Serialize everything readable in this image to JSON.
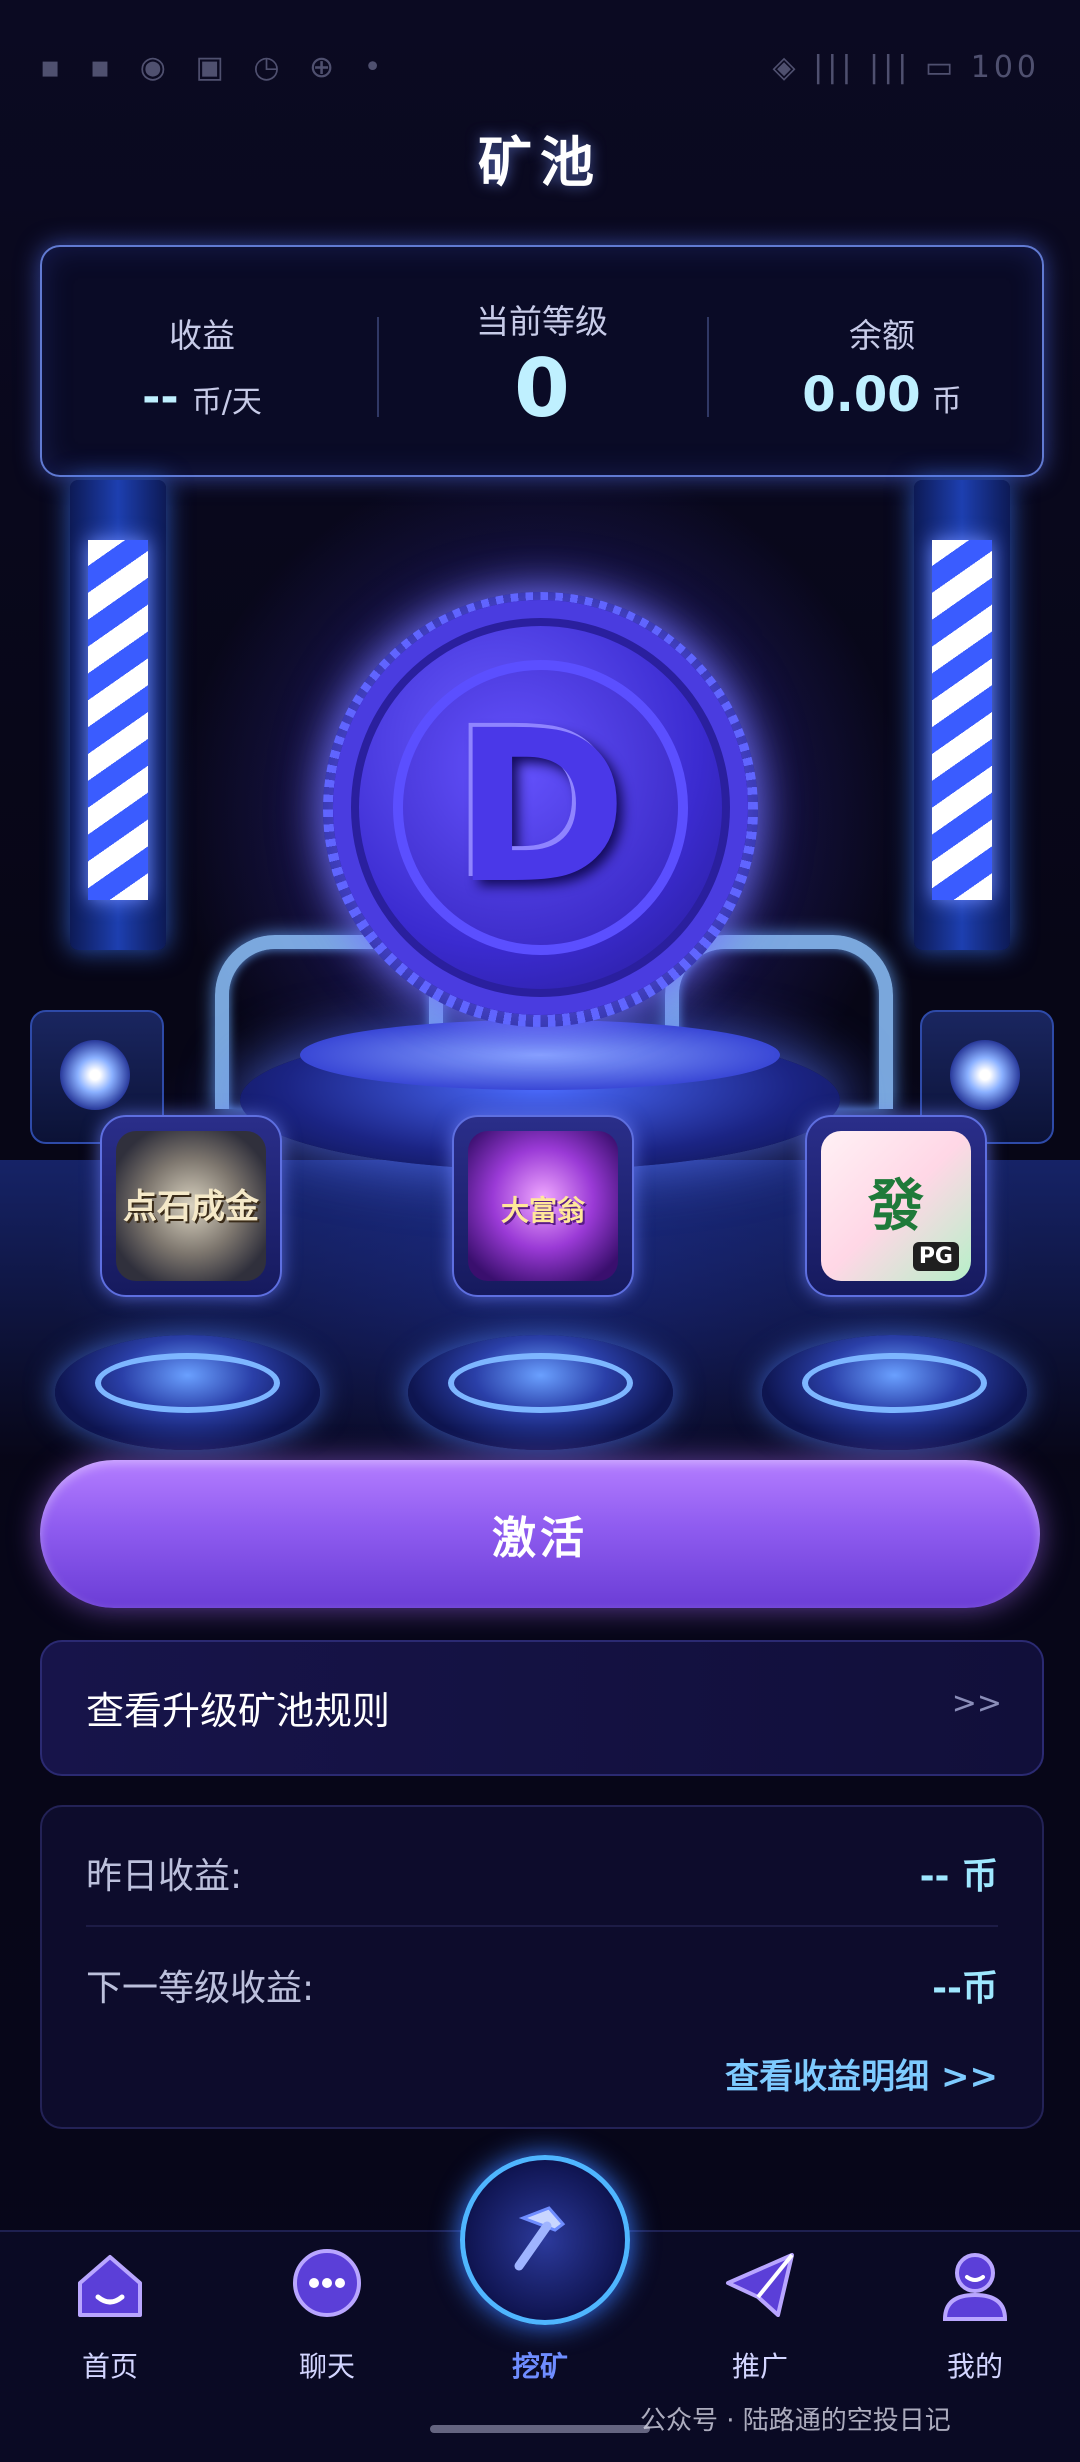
{
  "status_bar": {
    "left": "▪ ▪ ◉ ▣ ◷ ⊕ •",
    "right": "◈ ||| ||| ▭ 100"
  },
  "title": "矿池",
  "stats": {
    "income_label": "收益",
    "income_value": "--",
    "income_unit": "币/天",
    "level_label": "当前等级",
    "level_value": "0",
    "balance_label": "余额",
    "balance_value": "0.00",
    "balance_unit": "币"
  },
  "coin_letter": "D",
  "games": [
    {
      "icon": "game-icon-stone",
      "text": "点石成金"
    },
    {
      "icon": "game-icon-rich",
      "text": "大富翁"
    },
    {
      "icon": "game-icon-mahjong",
      "text": "發",
      "badge": "PG"
    }
  ],
  "activate_label": "激活",
  "rules": {
    "label": "查看升级矿池规则",
    "arrow": ">>"
  },
  "earnings": {
    "yesterday_label": "昨日收益:",
    "yesterday_value": "-- 币",
    "next_label": "下一等级收益:",
    "next_value": "--币",
    "detail_link": "查看收益明细 >>"
  },
  "nav": {
    "home": "首页",
    "chat": "聊天",
    "mine": "挖矿",
    "promote": "推广",
    "me": "我的"
  },
  "watermark": "公众号 · 陆路通的空投日记",
  "colors": {
    "accent": "#7ecbff",
    "button": "#9a66f2",
    "nav_active": "#6f8dff"
  }
}
